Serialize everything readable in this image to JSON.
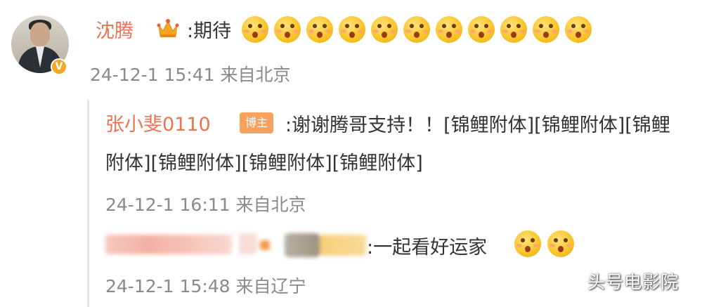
{
  "comment": {
    "username": "沈腾",
    "text": ":期待",
    "emoji_icon": "blush-emoji-icon",
    "emoji_count": 11,
    "time": "24-12-1 15:41 来自北京",
    "verified_badge": "V"
  },
  "replies": [
    {
      "username": "张小斐0110",
      "badge": "博主",
      "text_line1": ":谢谢腾哥支持！！[锦鲤附体][锦鲤附体][锦鲤",
      "text_line2": "附体][锦鲤附体][锦鲤附体][锦鲤附体]",
      "time": "24-12-1 16:11 来自北京"
    },
    {
      "username_blurred": true,
      "text": ":一起看好运家",
      "emoji_icon": "surprised-emoji-icon",
      "emoji_count": 2,
      "time": "24-12-1 15:48 来自辽宁"
    }
  ],
  "watermark": "头号电影院",
  "colors": {
    "username": "#eb7350",
    "text": "#333333",
    "meta": "#8a8a8a",
    "badge": "#f7a15c"
  }
}
